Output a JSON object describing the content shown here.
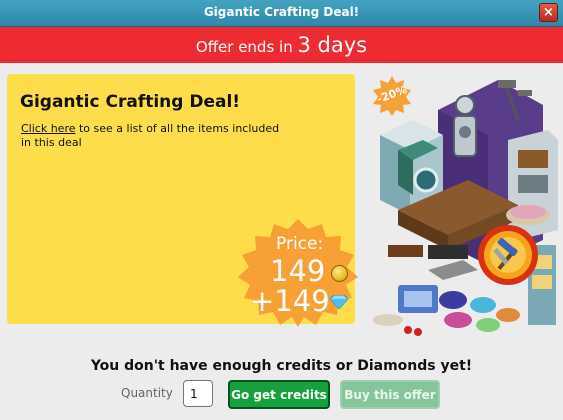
{
  "window": {
    "title": "Gigantic Crafting Deal!",
    "close_label": "×"
  },
  "banner": {
    "prefix": "Offer ends in ",
    "value": "3 days"
  },
  "deal": {
    "title": "Gigantic Crafting Deal!",
    "link_text": "Click here",
    "desc_rest": " to see a list of all the items included in this deal"
  },
  "price": {
    "label": "Price:",
    "credits": "149",
    "diamonds": "+149",
    "discount": "-20%"
  },
  "footer": {
    "warning": "You don't have enough credits or Diamonds yet!",
    "quantity_label": "Quantity",
    "quantity_value": "1",
    "get_credits_label": "Go get credits",
    "buy_label": "Buy this offer"
  },
  "colors": {
    "titlebar": "#2f88a9",
    "banner": "#ef2b32",
    "panel": "#fedd4a",
    "price_badge": "#f7a036",
    "primary_button": "#16a13f"
  },
  "icons": [
    "close-icon",
    "coin-icon",
    "diamond-icon",
    "hammer-pickaxe-icon"
  ]
}
